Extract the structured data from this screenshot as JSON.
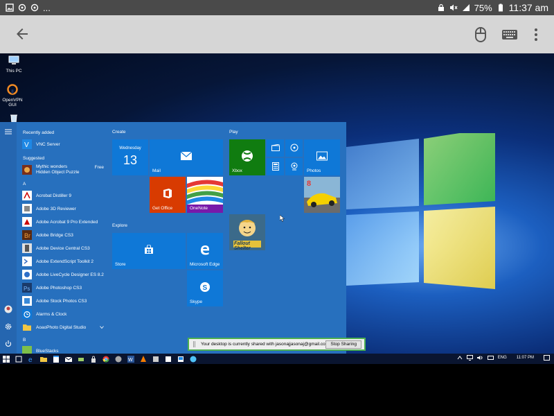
{
  "status_bar": {
    "left_icons": [
      "image-icon",
      "sync-icon",
      "sync-icon",
      "more-notifications-icon"
    ],
    "more_text": "...",
    "battery": "75%",
    "time": "11:37 am"
  },
  "app_bar": {
    "icons": [
      "back-arrow-icon",
      "mouse-icon",
      "keyboard-icon",
      "more-vert-icon"
    ]
  },
  "desktop": {
    "icons": [
      {
        "label": "This PC",
        "icon": "computer-icon"
      },
      {
        "label": "OpenVPN GUI",
        "icon": "openvpn-icon"
      },
      {
        "label": "",
        "icon": "recycle-bin-icon"
      }
    ]
  },
  "start_menu": {
    "recently_added": "Recently added",
    "vnc": "VNC Server",
    "suggested": "Suggested",
    "mythic_line1": "Mythic wonders",
    "mythic_line2": "Hidden Object Puzzle",
    "free": "Free",
    "letter_a": "A",
    "letter_b": "B",
    "apps": [
      "Acrobat Distiller 9",
      "Adobe 3D Reviewer",
      "Adobe Acrobat 9 Pro Extended",
      "Adobe Bridge CS3",
      "Adobe Device Central CS3",
      "Adobe ExtendScript Toolkit 2",
      "Adobe LiveCycle Designer ES 8.2",
      "Adobe Photoshop CS3",
      "Adobe Stock Photos CS3",
      "Alarms & Clock",
      "AoaoPhoto Digital Studio"
    ],
    "bluestacks": "BlueStacks",
    "groups": {
      "create": "Create",
      "play": "Play",
      "explore": "Explore"
    },
    "tiles": {
      "calendar_day": "Wednesday",
      "calendar_date": "13",
      "mail": "Mail",
      "get_office": "Get Office",
      "onenote": "OneNote",
      "xbox": "Xbox",
      "photos": "Photos",
      "store": "Store",
      "edge": "Microsoft Edge",
      "skype": "Skype",
      "fallout": "Fallout Shelter"
    }
  },
  "taskbar": {
    "language": "ENG",
    "time": "11:07 PM"
  },
  "share_banner": {
    "message": "Your desktop is currently shared with jasonajjasonaj@gmail.com",
    "stop_label": "Stop Sharing"
  },
  "colors": {
    "start_bg": "#2770be",
    "tile_blue": "#0f78d7",
    "xbox_green": "#107c10",
    "office_orange": "#d83b01",
    "share_border": "#4caf50"
  }
}
